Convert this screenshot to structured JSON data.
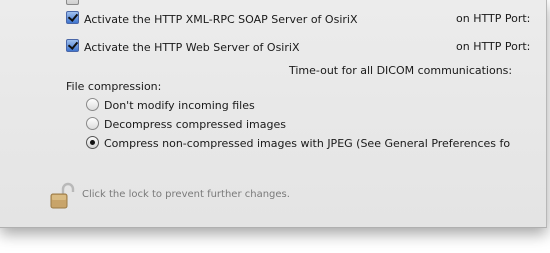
{
  "servers": {
    "xmlrpc_label": "Activate the HTTP XML-RPC SOAP Server of OsiriX",
    "xmlrpc_port_label": "on HTTP Port:",
    "web_label": "Activate the HTTP Web Server of OsiriX",
    "web_port_label": "on HTTP Port:",
    "timeout_label": "Time-out for all DICOM communications:"
  },
  "compression": {
    "heading": "File compression:",
    "options": [
      {
        "label": "Don't modify incoming files",
        "selected": false
      },
      {
        "label": "Decompress compressed images",
        "selected": false
      },
      {
        "label": "Compress non-compressed images with JPEG (See General Preferences fo",
        "selected": true
      }
    ]
  },
  "footer": {
    "lock_text": "Click the lock to prevent further changes.",
    "lock_icon": "unlocked-padlock-icon"
  }
}
